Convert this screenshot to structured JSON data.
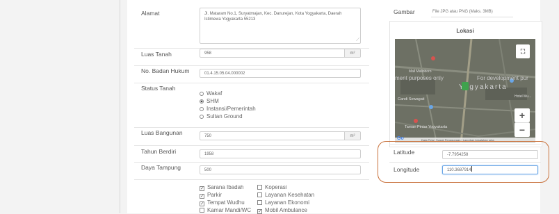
{
  "form": {
    "alamat": {
      "label": "Alamat",
      "value": "Jl. Mataram No.1, Suryatmajan, Kec. Danurejan, Kota Yogyakarta, Daerah Istimewa Yogyakarta 55213"
    },
    "luas_tanah": {
      "label": "Luas Tanah",
      "value": "958",
      "unit": "m²"
    },
    "badan_hukum": {
      "label": "No. Badan Hukum",
      "value": "01.4.15.05.04.000002"
    },
    "status_tanah": {
      "label": "Status Tanah",
      "options": [
        "Wakaf",
        "SHM",
        "Instansi/Pemerintah",
        "Sultan Ground"
      ],
      "selected": "SHM"
    },
    "luas_bangunan": {
      "label": "Luas Bangunan",
      "value": "750",
      "unit": "m²"
    },
    "tahun_berdiri": {
      "label": "Tahun Berdiri",
      "value": "1958"
    },
    "daya_tampung": {
      "label": "Daya Tampung",
      "value": "500"
    },
    "fasilitas_left": [
      {
        "label": "Sarana Ibadah",
        "checked": true
      },
      {
        "label": "Parkir",
        "checked": true
      },
      {
        "label": "Tempat Wudhu",
        "checked": true
      },
      {
        "label": "Kamar Mandi/WC",
        "checked": false
      }
    ],
    "fasilitas_right": [
      {
        "label": "Koperasi",
        "checked": false
      },
      {
        "label": "Layanan Kesehatan",
        "checked": false
      },
      {
        "label": "Layanan Ekonomi",
        "checked": false
      },
      {
        "label": "Mobil Ambulance",
        "checked": true
      }
    ]
  },
  "side": {
    "gambar_label": "Gambar",
    "gambar_hint": "File JPG atau PNG (Maks. 3MB)",
    "lokasi_title": "Lokasi",
    "map": {
      "watermark_left": "ment purposes only",
      "watermark_right": "For development pur",
      "city_label": "Yogyakarta",
      "place_left": "Candi Sewagati",
      "place_left2": "Mall Malioboro",
      "place_bottom": "Taman Pintar Yogyakarta",
      "place_right": "Hotel Mu...",
      "footer": "Data Peta | Syarat Penggunaan | Laporkan kesalahan peta",
      "zoom_in": "+",
      "zoom_out": "−",
      "fullscreen_icon": "fullscreen-icon"
    },
    "latitude": {
      "label": "Latitude",
      "value": "-7.7954258"
    },
    "longitude": {
      "label": "Longitude",
      "value": "110.3687914"
    }
  },
  "accent_colors": {
    "highlight_outline": "#c8703a",
    "focus_border": "#6aa6e6"
  }
}
